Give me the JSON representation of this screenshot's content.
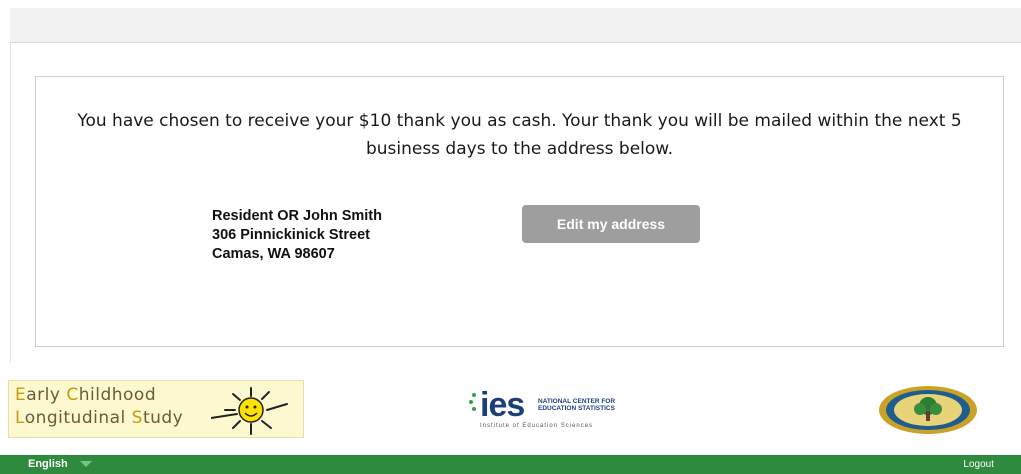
{
  "confirmation": {
    "message": "You have chosen to receive your $10 thank you as cash. Your thank you will be mailed within the next 5 business days to the address below.",
    "address_lines": [
      "Resident OR John Smith",
      "306 Pinnickinick Street",
      "Camas, WA 98607"
    ],
    "edit_button_label": "Edit my address"
  },
  "logos": {
    "ecls": {
      "line1": [
        "E",
        "arly ",
        "C",
        "hildhood"
      ],
      "line2": [
        "L",
        "ongitudinal ",
        "S",
        "tudy"
      ]
    },
    "ies": {
      "word": "ies",
      "nces_line1": "NATIONAL CENTER FOR",
      "nces_line2": "EDUCATION STATISTICS",
      "institute": "Institute of Education Sciences"
    }
  },
  "footer": {
    "language": "English",
    "logout": "Logout"
  },
  "colors": {
    "footer": "#2e8b3e",
    "button": "#9e9e9e",
    "ies_blue": "#1b3f7a"
  },
  "icons": [
    "language-dropdown-caret-icon",
    "sun-icon",
    "department-seal-icon"
  ]
}
